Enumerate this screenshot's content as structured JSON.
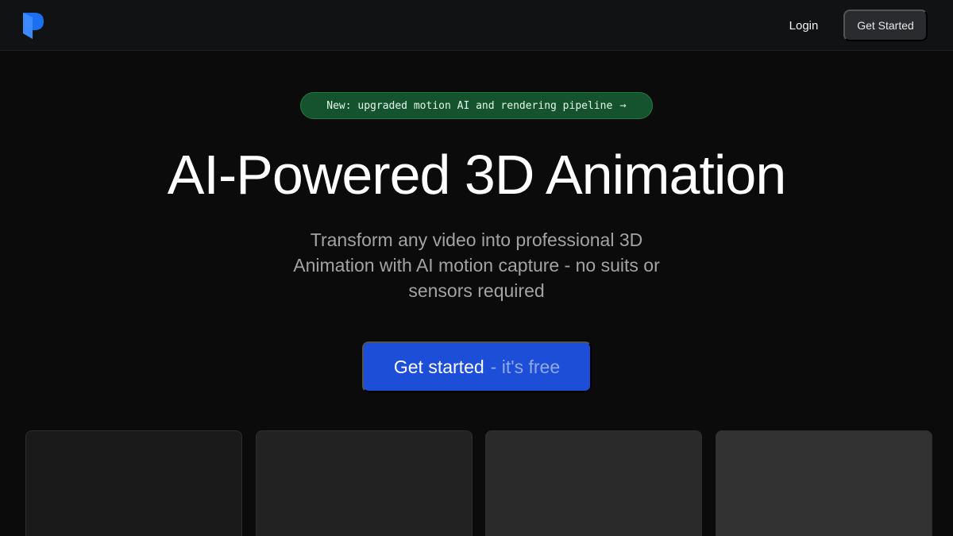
{
  "nav": {
    "logo_icon": "brand-logo-icon",
    "login_label": "Login",
    "cta_label": "Get Started"
  },
  "announcement": {
    "text": "New: upgraded motion AI and rendering pipeline",
    "arrow_icon": "→"
  },
  "hero": {
    "title": "AI-Powered 3D Animation",
    "subtitle": "Transform any video into professional 3D Animation with AI motion capture - no suits or sensors required",
    "cta_primary": "Get started",
    "cta_secondary": "- it's free"
  },
  "colors": {
    "accent": "#1d4ed8",
    "announcement_bg": "#14532d",
    "background": "#0b0b0b"
  }
}
